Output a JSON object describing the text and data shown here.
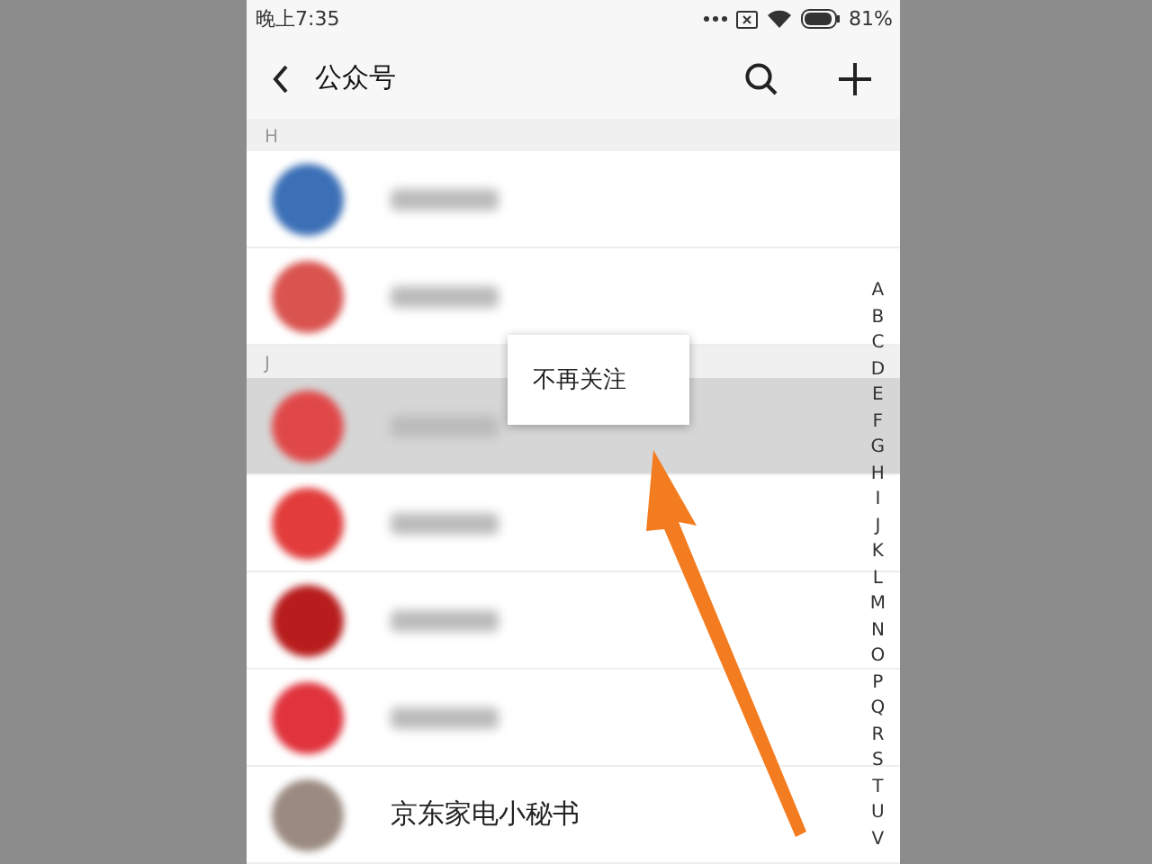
{
  "status_bar": {
    "time": "晚上7:35",
    "battery": "81%"
  },
  "header": {
    "title": "公众号"
  },
  "sections": [
    {
      "letter": "H",
      "rows": [
        {
          "color": "#3b6fb6",
          "selected": false
        },
        {
          "color": "#d9534f",
          "selected": false
        }
      ]
    },
    {
      "letter": "J",
      "rows": [
        {
          "color": "#e04848",
          "selected": true
        },
        {
          "color": "#e23c3c",
          "selected": false
        },
        {
          "color": "#b81c1c",
          "selected": false
        },
        {
          "color": "#e0333d",
          "selected": false
        },
        {
          "color": "#9a8a80",
          "selected": false,
          "name": "京东家电小秘书"
        }
      ]
    }
  ],
  "index_letters": [
    "A",
    "B",
    "C",
    "D",
    "E",
    "F",
    "G",
    "H",
    "I",
    "J",
    "K",
    "L",
    "M",
    "N",
    "O",
    "P",
    "Q",
    "R",
    "S",
    "T",
    "U",
    "V"
  ],
  "context_menu": {
    "items": [
      "不再关注"
    ]
  }
}
